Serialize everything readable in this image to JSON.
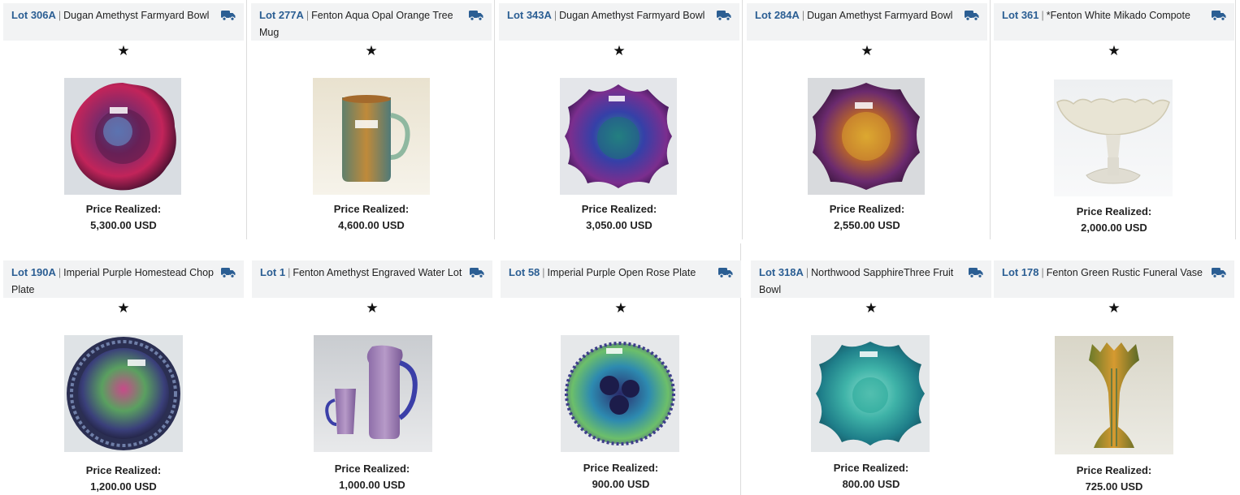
{
  "price_label": "Price Realized:",
  "lots": [
    {
      "lot": "Lot 306A",
      "title": "Dugan Amethyst Farmyard Bowl",
      "price": "5,300.00 USD",
      "photo": "amethyst-farmyard-bowl-photo"
    },
    {
      "lot": "Lot 277A",
      "title": "Fenton Aqua Opal Orange Tree Mug",
      "price": "4,600.00 USD",
      "photo": "aqua-opal-mug-photo"
    },
    {
      "lot": "Lot 343A",
      "title": "Dugan Amethyst Farmyard Bowl",
      "price": "3,050.00 USD",
      "photo": "amethyst-farmyard-bowl-photo"
    },
    {
      "lot": "Lot 284A",
      "title": "Dugan Amethyst Farmyard Bowl",
      "price": "2,550.00 USD",
      "photo": "amethyst-farmyard-bowl-photo"
    },
    {
      "lot": "Lot 361",
      "title": "*Fenton White Mikado Compote",
      "price": "2,000.00 USD",
      "photo": "white-compote-photo"
    },
    {
      "lot": "Lot 190A",
      "title": "Imperial Purple Homestead Chop Plate",
      "price": "1,200.00 USD",
      "photo": "purple-chop-plate-photo"
    },
    {
      "lot": "Lot 1",
      "title": "Fenton Amethyst Engraved Water Lot",
      "price": "1,000.00 USD",
      "photo": "water-set-photo"
    },
    {
      "lot": "Lot 58",
      "title": "Imperial Purple Open Rose Plate",
      "price": "900.00 USD",
      "photo": "open-rose-plate-photo"
    },
    {
      "lot": "Lot 318A",
      "title": "Northwood SapphireThree Fruit Bowl",
      "price": "800.00 USD",
      "photo": "sapphire-bowl-photo"
    },
    {
      "lot": "Lot 178",
      "title": "Fenton Green Rustic Funeral Vase",
      "price": "725.00 USD",
      "photo": "green-vase-photo"
    }
  ],
  "icons": {
    "shipping": "truck-icon",
    "favorite": "star-icon"
  },
  "colors": {
    "lot_link": "#2b5e93",
    "header_bg": "#f2f3f4"
  }
}
